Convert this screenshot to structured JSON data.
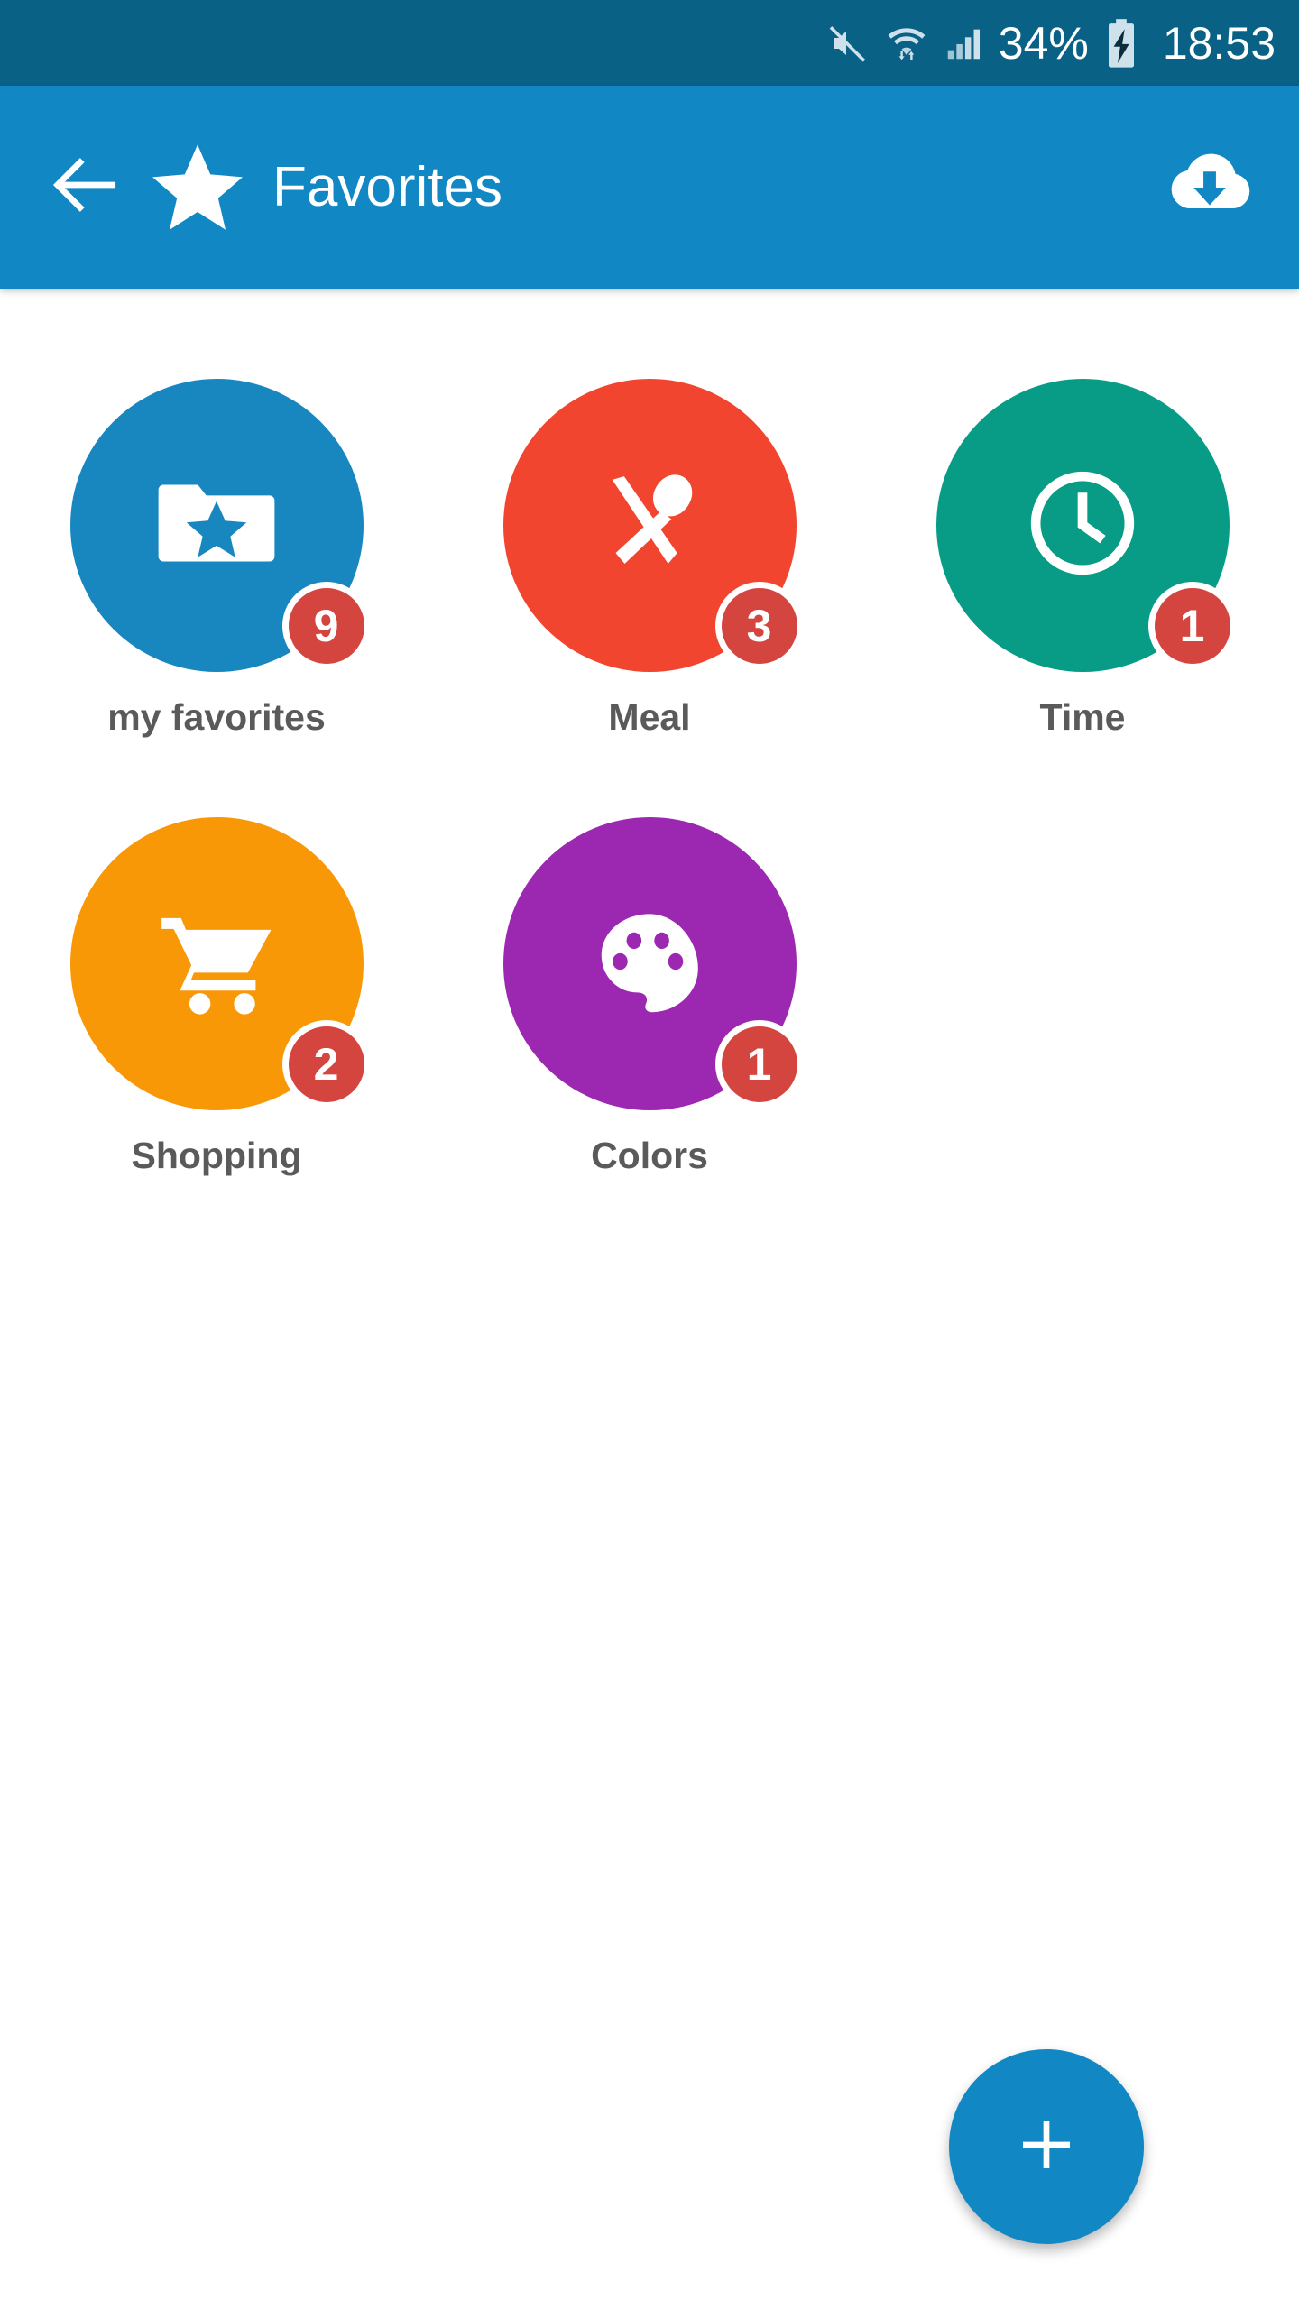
{
  "status_bar": {
    "background": "#0a6186",
    "mute_icon": "volume-mute-icon",
    "wifi_icon": "wifi-transfer-icon",
    "signal_icon": "cellular-signal-icon",
    "battery_percent": "34%",
    "battery_icon": "battery-charging-icon",
    "clock": "18:53"
  },
  "app_bar": {
    "background": "#1187c4",
    "back_icon": "arrow-left-icon",
    "star_icon": "star-icon",
    "title": "Favorites",
    "action_icon": "cloud-download-icon"
  },
  "tiles": [
    {
      "label": "my favorites",
      "badge": "9",
      "color": "#1887c0",
      "icon": "folder-star-icon"
    },
    {
      "label": "Meal",
      "badge": "3",
      "color": "#f2452f",
      "icon": "cutlery-icon"
    },
    {
      "label": "Time",
      "badge": "1",
      "color": "#089c86",
      "icon": "clock-icon"
    },
    {
      "label": "Shopping",
      "badge": "2",
      "color": "#f99806",
      "icon": "shopping-cart-icon"
    },
    {
      "label": "Colors",
      "badge": "1",
      "color": "#9c28b1",
      "icon": "palette-icon"
    }
  ],
  "badge_color": "#d4453f",
  "fab": {
    "icon": "plus-icon",
    "color": "#1187c4"
  }
}
